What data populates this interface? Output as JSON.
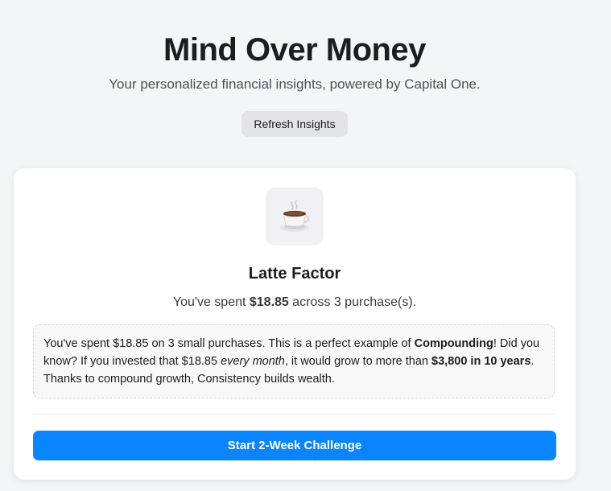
{
  "header": {
    "title": "Mind Over Money",
    "subtitle": "Your personalized financial insights, powered by Capital One.",
    "refresh_label": "Refresh Insights"
  },
  "card": {
    "icon": "coffee-cup-icon",
    "title": "Latte Factor",
    "summary": {
      "prefix": "You've spent ",
      "amount": "$18.85",
      "suffix": " across 3 purchase(s)."
    },
    "insight": {
      "part1": "You've spent $18.85 on 3 small purchases. This is a perfect example of ",
      "concept": "Compounding",
      "part2": "! Did you know? If you invested that $18.85 ",
      "frequency": "every month",
      "part3": ", it would grow to more than ",
      "projection": "$3,800 in 10 years",
      "part4": ". Thanks to compound growth, Consistency builds wealth."
    },
    "challenge_label": "Start 2-Week Challenge"
  },
  "colors": {
    "background": "#f4f5f7",
    "accent": "#0a84ff",
    "card": "#ffffff"
  }
}
